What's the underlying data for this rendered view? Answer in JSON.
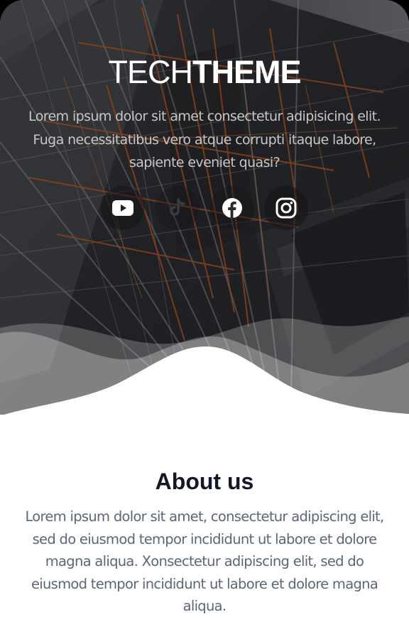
{
  "hero": {
    "brand_light": "TECH",
    "brand_bold": "THEME",
    "description": "Lorem ipsum dolor sit amet consectetur adipisicing elit. Fuga necessitatibus vero atque corrupti itaque labore, sapiente eveniet quasi?",
    "social": [
      {
        "icon": "youtube-icon"
      },
      {
        "icon": "tiktok-icon"
      },
      {
        "icon": "facebook-icon"
      },
      {
        "icon": "instagram-icon"
      }
    ]
  },
  "about": {
    "title": "About us",
    "body": "Lorem ipsum dolor sit amet, consectetur adipiscing elit, sed do eiusmod tempor incididunt ut labore et dolore magna aliqua. Xonsectetur adipiscing elit, sed do eiusmod tempor incididunt ut labore et dolore magna aliqua."
  },
  "colors": {
    "hero_dark": "#2b2c30",
    "accent_orange": "#c2571f",
    "title": "#111827",
    "body_text": "#5b6678"
  }
}
